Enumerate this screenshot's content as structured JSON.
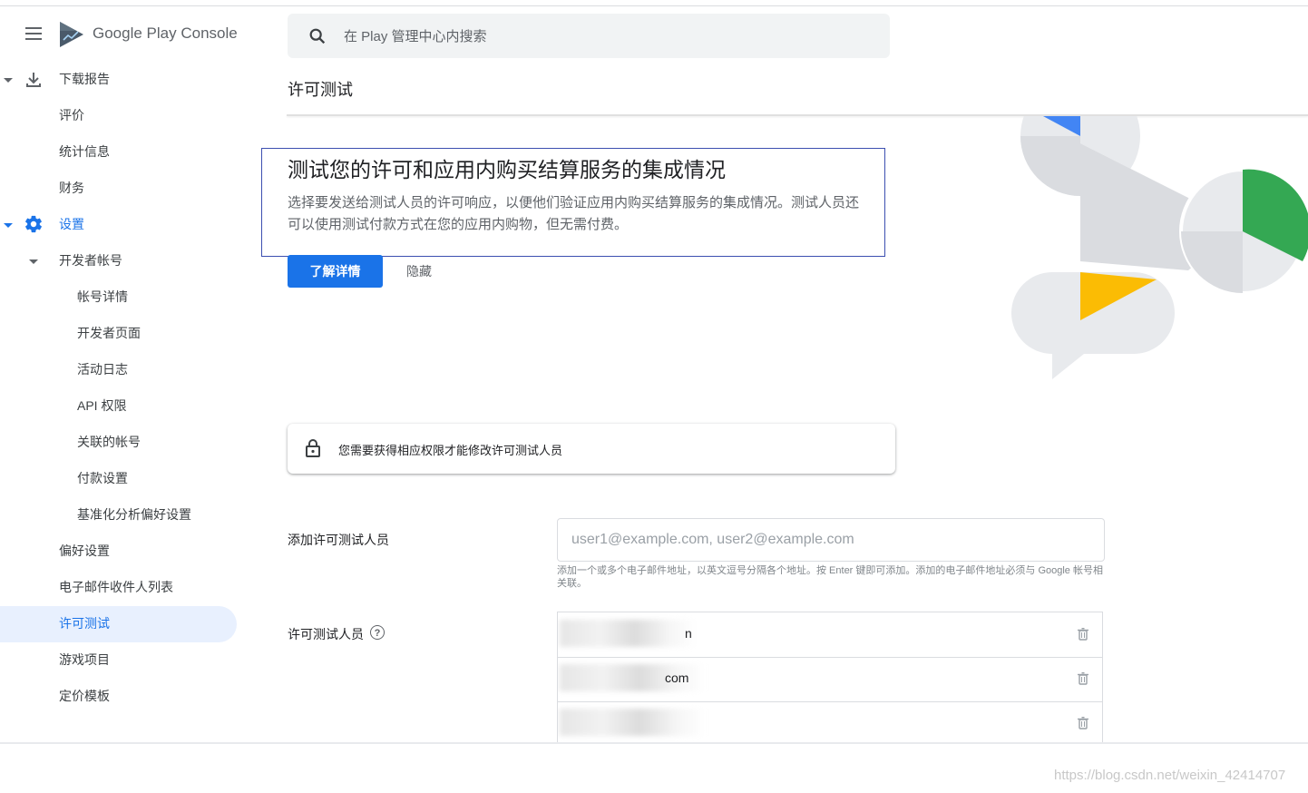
{
  "app": {
    "logo_google": "Google Play",
    "logo_console": "Console"
  },
  "search": {
    "placeholder": "在 Play 管理中心内搜索"
  },
  "sidebar": {
    "items": [
      {
        "label": "下载报告"
      },
      {
        "label": "评价"
      },
      {
        "label": "统计信息"
      },
      {
        "label": "财务"
      },
      {
        "label": "设置"
      },
      {
        "label": "开发者帐号"
      },
      {
        "label": "帐号详情"
      },
      {
        "label": "开发者页面"
      },
      {
        "label": "活动日志"
      },
      {
        "label": "API 权限"
      },
      {
        "label": "关联的帐号"
      },
      {
        "label": "付款设置"
      },
      {
        "label": "基准化分析偏好设置"
      },
      {
        "label": "偏好设置"
      },
      {
        "label": "电子邮件收件人列表"
      },
      {
        "label": "许可测试"
      },
      {
        "label": "游戏项目"
      },
      {
        "label": "定价模板"
      }
    ],
    "active_item": "许可测试"
  },
  "page": {
    "title": "许可测试"
  },
  "banner": {
    "heading": "测试您的许可和应用内购买结算服务的集成情况",
    "body": "选择要发送给测试人员的许可响应，以便他们验证应用内购买结算服务的集成情况。测试人员还可以使用测试付款方式在您的应用内购物，但无需付费。",
    "learn_more": "了解详情",
    "hide": "隐藏"
  },
  "permission_notice": {
    "text": "您需要获得相应权限才能修改许可测试人员"
  },
  "form": {
    "add_label": "添加许可测试人员",
    "add_placeholder": "user1@example.com, user2@example.com",
    "add_helper": "添加一个或多个电子邮件地址，以英文逗号分隔各个地址。按 Enter 键即可添加。添加的电子邮件地址必须与 Google 帐号相关联。",
    "testers_label": "许可测试人员",
    "help_glyph": "?",
    "testers": [
      {
        "email_visible": "n"
      },
      {
        "email_visible": "com"
      },
      {
        "email_visible": ""
      }
    ]
  },
  "colors": {
    "accent": "#1a73e8",
    "active_bg": "#e8f0fe",
    "illustration_blue": "#4285f4",
    "illustration_green": "#34a853",
    "illustration_yellow": "#fbbc04",
    "illustration_gray": "#dadce0"
  },
  "watermark": "https://blog.csdn.net/weixin_42414707"
}
